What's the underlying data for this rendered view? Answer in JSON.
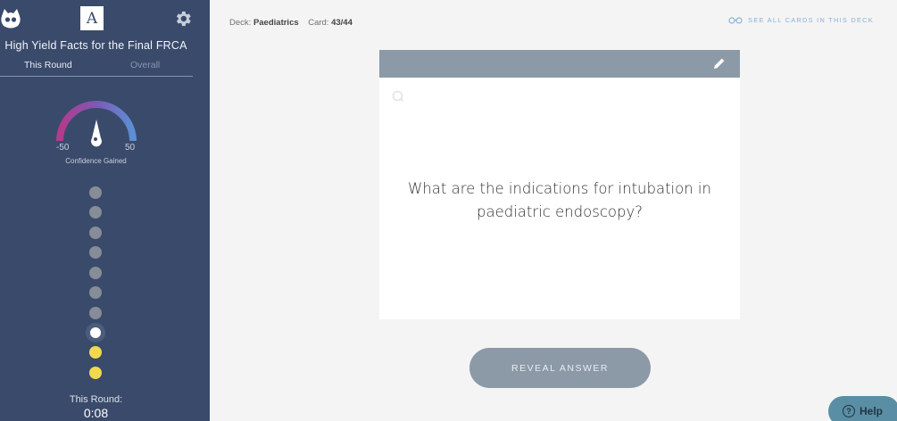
{
  "sidebar": {
    "logo_letter": "A",
    "deck_title": "High Yield Facts for the Final FRCA",
    "tabs": {
      "this_round": "This Round",
      "overall": "Overall"
    },
    "gauge": {
      "min": "-50",
      "max": "50",
      "label": "Confidence Gained"
    },
    "progress": [
      "grey",
      "grey",
      "grey",
      "grey",
      "grey",
      "grey",
      "grey",
      "current",
      "yellow",
      "yellow"
    ],
    "round_label": "This Round:",
    "round_time": "0:08"
  },
  "header": {
    "deck_prefix": "Deck:",
    "deck_name": "Paediatrics",
    "card_prefix": "Card:",
    "card_position": "43/44",
    "see_all": "SEE ALL CARDS IN THIS DECK"
  },
  "card": {
    "question": "What are the indications for intubation in paediatric endoscopy?"
  },
  "actions": {
    "reveal": "REVEAL ANSWER"
  },
  "help": {
    "label": "Help",
    "icon": "?"
  },
  "colors": {
    "sidebar": "#3a4a6b",
    "card_header": "#8c99a7",
    "accent_yellow": "#f2d84e",
    "link": "#89b1d8",
    "help": "#5a8ea4"
  }
}
